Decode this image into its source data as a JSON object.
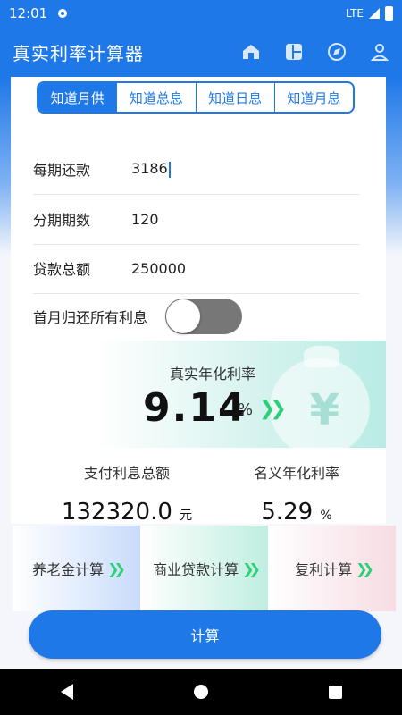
{
  "status": {
    "time": "12:01",
    "network": "LTE"
  },
  "appbar": {
    "title": "真实利率计算器"
  },
  "tabs": [
    "知道月供",
    "知道总息",
    "知道日息",
    "知道月息"
  ],
  "form": {
    "payment_label": "每期还款",
    "payment_value": "3186",
    "periods_label": "分期期数",
    "periods_value": "120",
    "loan_label": "贷款总额",
    "loan_value": "250000",
    "toggle_label": "首月归还所有利息"
  },
  "result": {
    "rate_label": "真实年化利率",
    "rate_value": "9.14",
    "rate_unit": "%",
    "interest_label": "支付利息总额",
    "interest_value": "132320.0",
    "interest_unit": "元",
    "nominal_label": "名义年化利率",
    "nominal_value": "5.29",
    "nominal_unit": "%"
  },
  "quick": [
    "养老金计算",
    "商业贷款计算",
    "复利计算"
  ],
  "calc_button": "计算"
}
